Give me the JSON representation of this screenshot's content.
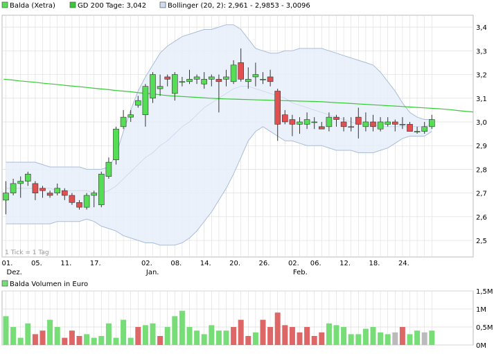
{
  "colors": {
    "up": "#55dd55",
    "down": "#e05050",
    "gd200": "#33cc33",
    "bollinger_fill": "#e6eef9",
    "bollinger_line": "#a9bcd9",
    "grid": "#dddddd",
    "volume_up": "#77dd77",
    "volume_down": "#dd6666",
    "volume_neutral": "#bbbbbb"
  },
  "legend": {
    "stock": "Balda (Xetra)",
    "gd200": "GD 200 Tage: 3,042",
    "bollinger": "Bollinger (20, 2): 2,961 - 2,9853 - 3,0096"
  },
  "tick_note": "1 Tick = 1 Tag",
  "volume_legend": "Balda Volumen in Euro",
  "chart_data": [
    {
      "type": "candlestick",
      "name": "Balda (Xetra)",
      "yticks": [
        "3,4",
        "3,3",
        "3,2",
        "3,1",
        "3,0",
        "2,9",
        "2,8",
        "2,7",
        "2,6",
        "2,5"
      ],
      "ylim": [
        2.43,
        3.45
      ],
      "xticks": [
        {
          "label": "01.",
          "sub": "Dez.",
          "i": 0
        },
        {
          "label": "05.",
          "sub": "",
          "i": 4
        },
        {
          "label": "11.",
          "sub": "",
          "i": 8
        },
        {
          "label": "17.",
          "sub": "",
          "i": 12
        },
        {
          "label": "02.",
          "sub": "Jan.",
          "i": 19
        },
        {
          "label": "08.",
          "sub": "",
          "i": 23
        },
        {
          "label": "14.",
          "sub": "",
          "i": 27
        },
        {
          "label": "20.",
          "sub": "",
          "i": 31
        },
        {
          "label": "26.",
          "sub": "",
          "i": 35
        },
        {
          "label": "02.",
          "sub": "Feb.",
          "i": 39
        },
        {
          "label": "06.",
          "sub": "",
          "i": 42
        },
        {
          "label": "12.",
          "sub": "",
          "i": 46
        },
        {
          "label": "18.",
          "sub": "",
          "i": 50
        },
        {
          "label": "24.",
          "sub": "",
          "i": 54
        }
      ],
      "candles": [
        [
          2.67,
          2.7,
          2.75,
          2.61
        ],
        [
          2.7,
          2.74,
          2.76,
          2.69
        ],
        [
          2.74,
          2.75,
          2.77,
          2.68
        ],
        [
          2.75,
          2.78,
          2.79,
          2.73
        ],
        [
          2.74,
          2.7,
          2.75,
          2.67
        ],
        [
          2.72,
          2.71,
          2.73,
          2.68
        ],
        [
          2.7,
          2.69,
          2.71,
          2.68
        ],
        [
          2.7,
          2.72,
          2.74,
          2.69
        ],
        [
          2.71,
          2.69,
          2.72,
          2.67
        ],
        [
          2.69,
          2.66,
          2.7,
          2.65
        ],
        [
          2.66,
          2.64,
          2.67,
          2.63
        ],
        [
          2.64,
          2.69,
          2.7,
          2.63
        ],
        [
          2.69,
          2.7,
          2.71,
          2.64
        ],
        [
          2.65,
          2.78,
          2.79,
          2.64
        ],
        [
          2.77,
          2.83,
          2.85,
          2.76
        ],
        [
          2.84,
          2.97,
          2.98,
          2.82
        ],
        [
          2.98,
          3.02,
          3.05,
          2.97
        ],
        [
          3.02,
          3.03,
          3.05,
          3.0
        ],
        [
          3.07,
          3.09,
          3.11,
          3.06
        ],
        [
          3.03,
          3.15,
          3.16,
          2.98
        ],
        [
          3.1,
          3.2,
          3.21,
          3.08
        ],
        [
          3.14,
          3.15,
          3.2,
          3.11
        ],
        [
          3.19,
          3.18,
          3.2,
          3.15
        ],
        [
          3.12,
          3.2,
          3.21,
          3.09
        ],
        [
          3.17,
          3.17,
          3.19,
          3.15
        ],
        [
          3.17,
          3.18,
          3.22,
          3.16
        ],
        [
          3.18,
          3.19,
          3.2,
          3.16
        ],
        [
          3.16,
          3.18,
          3.21,
          3.14
        ],
        [
          3.18,
          3.19,
          3.2,
          3.15
        ],
        [
          3.18,
          3.17,
          3.2,
          3.04
        ],
        [
          3.18,
          3.19,
          3.22,
          3.15
        ],
        [
          3.17,
          3.24,
          3.26,
          3.16
        ],
        [
          3.25,
          3.18,
          3.31,
          3.17
        ],
        [
          3.17,
          3.18,
          3.23,
          3.14
        ],
        [
          3.19,
          3.2,
          3.25,
          3.15
        ],
        [
          3.18,
          3.18,
          3.21,
          3.16
        ],
        [
          3.19,
          3.17,
          3.22,
          3.15
        ],
        [
          3.13,
          2.99,
          3.14,
          2.92
        ],
        [
          3.03,
          3.0,
          3.05,
          2.99
        ],
        [
          3.01,
          2.99,
          3.03,
          2.94
        ],
        [
          2.99,
          3.0,
          3.02,
          2.95
        ],
        [
          2.99,
          3.01,
          3.04,
          2.97
        ],
        [
          3.0,
          3.0,
          3.02,
          2.97
        ],
        [
          2.98,
          2.97,
          3.0,
          2.97
        ],
        [
          2.98,
          3.02,
          3.04,
          2.96
        ],
        [
          3.02,
          3.01,
          3.03,
          2.98
        ],
        [
          3.0,
          2.98,
          3.02,
          2.96
        ],
        [
          2.98,
          2.98,
          3.02,
          2.96
        ],
        [
          3.02,
          2.99,
          3.06,
          2.93
        ],
        [
          2.98,
          3.0,
          3.04,
          2.96
        ],
        [
          3.0,
          2.98,
          3.03,
          2.96
        ],
        [
          2.97,
          3.0,
          3.02,
          2.96
        ],
        [
          2.99,
          3.0,
          3.02,
          2.98
        ],
        [
          3.0,
          2.99,
          3.01,
          2.96
        ],
        [
          2.99,
          2.99,
          3.02,
          2.97
        ],
        [
          2.99,
          2.96,
          3.0,
          2.96
        ],
        [
          2.96,
          2.96,
          2.98,
          2.95
        ],
        [
          2.96,
          2.98,
          3.0,
          2.95
        ],
        [
          2.98,
          3.01,
          3.03,
          2.97
        ]
      ],
      "overlays": [
        {
          "name": "GD 200 Tage",
          "values": [
            3.18,
            3.177,
            3.173,
            3.17,
            3.167,
            3.163,
            3.16,
            3.157,
            3.153,
            3.15,
            3.147,
            3.143,
            3.14,
            3.137,
            3.133,
            3.13,
            3.127,
            3.123,
            3.12,
            3.117,
            3.113,
            3.11,
            3.108,
            3.106,
            3.104,
            3.102,
            3.1,
            3.098,
            3.097,
            3.096,
            3.095,
            3.094,
            3.093,
            3.092,
            3.091,
            3.09,
            3.089,
            3.088,
            3.087,
            3.086,
            3.085,
            3.083,
            3.081,
            3.079,
            3.077,
            3.075,
            3.073,
            3.071,
            3.069,
            3.067,
            3.065,
            3.063,
            3.061,
            3.059,
            3.057,
            3.055,
            3.052,
            3.048,
            3.045,
            3.042
          ]
        }
      ],
      "bollinger": {
        "name": "Bollinger (20, 2)",
        "upper": [
          2.83,
          2.83,
          2.83,
          2.83,
          2.83,
          2.82,
          2.81,
          2.81,
          2.81,
          2.81,
          2.81,
          2.8,
          2.8,
          2.8,
          2.81,
          2.86,
          2.96,
          3.05,
          3.13,
          3.19,
          3.24,
          3.29,
          3.32,
          3.34,
          3.36,
          3.37,
          3.38,
          3.39,
          3.39,
          3.4,
          3.41,
          3.41,
          3.39,
          3.35,
          3.31,
          3.3,
          3.29,
          3.29,
          3.3,
          3.3,
          3.31,
          3.31,
          3.31,
          3.31,
          3.3,
          3.29,
          3.28,
          3.27,
          3.26,
          3.25,
          3.24,
          3.21,
          3.17,
          3.13,
          3.08,
          3.04,
          3.02,
          3.01,
          3.01
        ],
        "middle": [
          2.72,
          2.72,
          2.72,
          2.72,
          2.72,
          2.72,
          2.72,
          2.71,
          2.71,
          2.71,
          2.71,
          2.71,
          2.7,
          2.7,
          2.71,
          2.73,
          2.76,
          2.79,
          2.82,
          2.85,
          2.87,
          2.9,
          2.92,
          2.95,
          2.98,
          3.0,
          3.03,
          3.06,
          3.08,
          3.1,
          3.12,
          3.14,
          3.15,
          3.15,
          3.14,
          3.13,
          3.12,
          3.11,
          3.1,
          3.08,
          3.07,
          3.06,
          3.05,
          3.04,
          3.03,
          3.02,
          3.01,
          3.0,
          2.99,
          2.99,
          2.99,
          2.98,
          2.98,
          2.98,
          2.98,
          2.98,
          2.98,
          2.98,
          2.99
        ],
        "lower": [
          2.57,
          2.57,
          2.57,
          2.57,
          2.57,
          2.57,
          2.57,
          2.58,
          2.58,
          2.58,
          2.58,
          2.59,
          2.58,
          2.56,
          2.55,
          2.54,
          2.52,
          2.51,
          2.5,
          2.49,
          2.49,
          2.48,
          2.48,
          2.48,
          2.49,
          2.51,
          2.54,
          2.58,
          2.62,
          2.67,
          2.72,
          2.78,
          2.85,
          2.92,
          2.96,
          2.98,
          2.96,
          2.94,
          2.92,
          2.92,
          2.91,
          2.9,
          2.9,
          2.9,
          2.89,
          2.88,
          2.88,
          2.88,
          2.87,
          2.87,
          2.87,
          2.88,
          2.89,
          2.91,
          2.93,
          2.94,
          2.94,
          2.94,
          2.96
        ]
      }
    },
    {
      "type": "bar",
      "name": "Balda Volumen in Euro",
      "yticks": [
        "1,5M",
        "1M",
        "0,5M",
        "0M"
      ],
      "ylim": [
        0,
        1.5
      ],
      "unit": "M",
      "values": [
        0.8,
        0.5,
        0.2,
        0.6,
        0.3,
        0.4,
        0.7,
        0.5,
        0.2,
        0.4,
        0.25,
        0.3,
        0.2,
        0.25,
        0.6,
        0.2,
        0.7,
        0.2,
        0.5,
        0.55,
        0.6,
        0.25,
        0.5,
        0.8,
        0.95,
        0.5,
        0.4,
        0.3,
        0.55,
        0.4,
        0.4,
        0.5,
        0.7,
        0.25,
        0.35,
        0.7,
        0.5,
        0.9,
        0.55,
        0.5,
        0.35,
        0.5,
        0.25,
        0.35,
        0.6,
        0.55,
        0.5,
        0.3,
        0.3,
        0.45,
        0.5,
        0.35,
        0.3,
        0.35,
        0.5,
        0.3,
        0.4,
        0.35,
        0.4
      ],
      "directions": [
        "up",
        "up",
        "up",
        "up",
        "down",
        "down",
        "up",
        "up",
        "down",
        "down",
        "down",
        "up",
        "up",
        "up",
        "up",
        "up",
        "up",
        "up",
        "down",
        "up",
        "up",
        "down",
        "up",
        "up",
        "up",
        "up",
        "up",
        "up",
        "up",
        "up",
        "up",
        "down",
        "down",
        "down",
        "up",
        "down",
        "down",
        "down",
        "down",
        "down",
        "down",
        "down",
        "down",
        "down",
        "up",
        "up",
        "up",
        "up",
        "up",
        "up",
        "up",
        "up",
        "up",
        "neutral",
        "down",
        "up",
        "up",
        "neutral",
        "up"
      ]
    }
  ]
}
